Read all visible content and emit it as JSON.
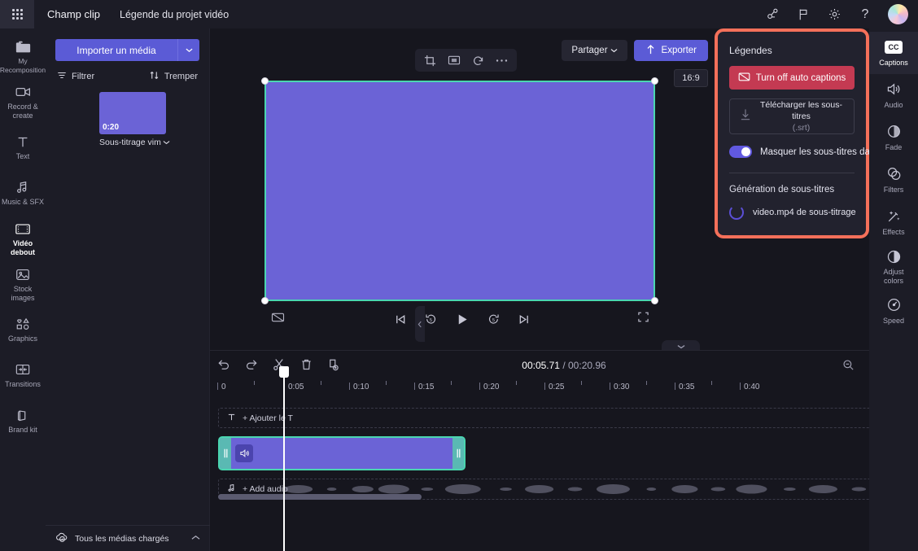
{
  "topbar": {
    "app_name": "Champ clip",
    "project_name": "Légende du projet vidéo",
    "icons": [
      "share-nodes-icon",
      "flag-icon",
      "gear-icon",
      "help-icon"
    ],
    "help_label": "?"
  },
  "left_rail": {
    "items": [
      {
        "label": "My Recomposition",
        "icon": "folder-icon",
        "active": false
      },
      {
        "label": "Record &\ncreate",
        "icon": "camera-icon",
        "active": false
      },
      {
        "label": "Text",
        "icon": "text-icon",
        "active": false
      },
      {
        "label": "Music & SFX",
        "icon": "music-icon",
        "active": false
      },
      {
        "label": "Vidéo debout",
        "icon": "film-icon",
        "active": true
      },
      {
        "label": "Stock\nimages",
        "icon": "image-icon",
        "active": false
      },
      {
        "label": "Graphics",
        "icon": "shapes-icon",
        "active": false
      },
      {
        "label": "Transitions",
        "icon": "transitions-icon",
        "active": false
      },
      {
        "label": "Brand kit",
        "icon": "brandkit-icon",
        "active": false
      }
    ]
  },
  "media_panel": {
    "import_label": "Importer un média",
    "import_caret": "chevron-down-icon",
    "filter_label": "Filtrer",
    "sort_label": "Tremper",
    "thumbnail": {
      "duration": "0:20",
      "caption": "Sous-titrage vim"
    },
    "footer_label": "Tous les médias chargés"
  },
  "preview": {
    "share_label": "Partager",
    "export_label": "Exporter",
    "aspect_ratio": "16:9",
    "canvas_tools": [
      "crop-icon",
      "fit-icon",
      "rotate-icon",
      "more-icon"
    ],
    "controls": {
      "captions": "captions-off-icon",
      "prev": "skip-previous-icon",
      "back5": "rewind-5-icon",
      "play": "play-icon",
      "fwd5": "forward-5-icon",
      "next": "skip-next-icon",
      "fullscreen": "fullscreen-icon"
    },
    "comment_icon": "comment-bubble-icon"
  },
  "timeline": {
    "tools_left": [
      "undo-icon",
      "redo-icon",
      "split-icon",
      "delete-icon",
      "duplicate-icon"
    ],
    "current_time": "00:05.71",
    "separator": " / ",
    "total_time": "00:20.96",
    "tools_right": [
      "zoom-out-icon",
      "zoom-in-icon",
      "fit-timeline-icon"
    ],
    "ruler_ticks": [
      "0",
      "0:05",
      "0:10",
      "0:15",
      "0:20",
      "0:25",
      "0:30",
      "0:35",
      "0:40"
    ],
    "text_track_label": "+ Ajouter le T",
    "audio_track_label": "+ Add audio",
    "clip": {
      "left_grip": "trim-handle",
      "right_grip": "trim-handle",
      "audio_icon": "volume-icon"
    }
  },
  "captions_panel": {
    "title": "Légendes",
    "turn_off_label": "Turn off auto captions",
    "turn_off_icon": "captions-off-icon",
    "download_label": "Télécharger les sous-titres",
    "download_sub": "(.srt)",
    "download_icon": "download-icon",
    "hide_toggle_label": "Masquer les sous-titres dans la vidéo",
    "hide_toggle_on": true,
    "generation_title": "Génération de sous-titres",
    "generation_item": "video.mp4 de sous-titrage"
  },
  "right_rail": {
    "items": [
      {
        "label": "Captions",
        "icon": "cc-icon",
        "active": true
      },
      {
        "label": "Audio",
        "icon": "speaker-icon",
        "active": false
      },
      {
        "label": "Fade",
        "icon": "fade-icon",
        "active": false
      },
      {
        "label": "Filters",
        "icon": "filters-icon",
        "active": false
      },
      {
        "label": "Effects",
        "icon": "effects-wand-icon",
        "active": false
      },
      {
        "label": "Adjust\ncolors",
        "icon": "contrast-icon",
        "active": false
      },
      {
        "label": "Speed",
        "icon": "speedometer-icon",
        "active": false
      }
    ]
  },
  "colors": {
    "accent": "#5b5bd6",
    "danger": "#c43a52",
    "highlight_border": "#f4705a",
    "clip_fill": "#6b63d6",
    "clip_border": "#4ad6b0",
    "bg": "#16161e",
    "panel": "#1c1c26"
  }
}
